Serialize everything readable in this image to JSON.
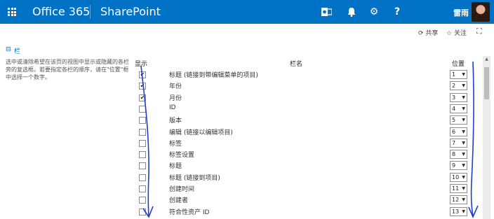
{
  "header": {
    "brand": "Office 365",
    "site": "SharePoint",
    "user_name": "雷雨",
    "icons": [
      "waffle-icon",
      "outlook-icon",
      "bell-icon",
      "gear-icon",
      "help-icon"
    ]
  },
  "actions": {
    "share": "共享",
    "follow": "关注"
  },
  "section": {
    "title": "栏",
    "description": "选中或清除希望在该页的视图中显示或隐藏的各栏旁的复选框。若要指定各栏的顺序，请在\"位置\"框中选择一个数字。"
  },
  "table": {
    "headers": {
      "show": "显示",
      "name": "栏名",
      "position": "位置"
    },
    "rows": [
      {
        "name": "标题 (链接到带编辑菜单的项目)",
        "checked": true,
        "position": "1"
      },
      {
        "name": "年份",
        "checked": true,
        "position": "2"
      },
      {
        "name": "月份",
        "checked": true,
        "position": "3"
      },
      {
        "name": "ID",
        "checked": false,
        "position": "4"
      },
      {
        "name": "版本",
        "checked": false,
        "position": "5"
      },
      {
        "name": "编辑 (链接以编辑项目)",
        "checked": false,
        "position": "6"
      },
      {
        "name": "标签",
        "checked": false,
        "position": "7"
      },
      {
        "name": "标签设置",
        "checked": false,
        "position": "8"
      },
      {
        "name": "标题",
        "checked": false,
        "position": "9"
      },
      {
        "name": "标题 (链接到项目)",
        "checked": false,
        "position": "10"
      },
      {
        "name": "创建时间",
        "checked": false,
        "position": "11"
      },
      {
        "name": "创建者",
        "checked": false,
        "position": "12"
      },
      {
        "name": "符合性资产 ID",
        "checked": false,
        "position": "13"
      }
    ]
  },
  "colors": {
    "brand_blue": "#0072c6",
    "annotation_blue": "#1f3fd0"
  }
}
